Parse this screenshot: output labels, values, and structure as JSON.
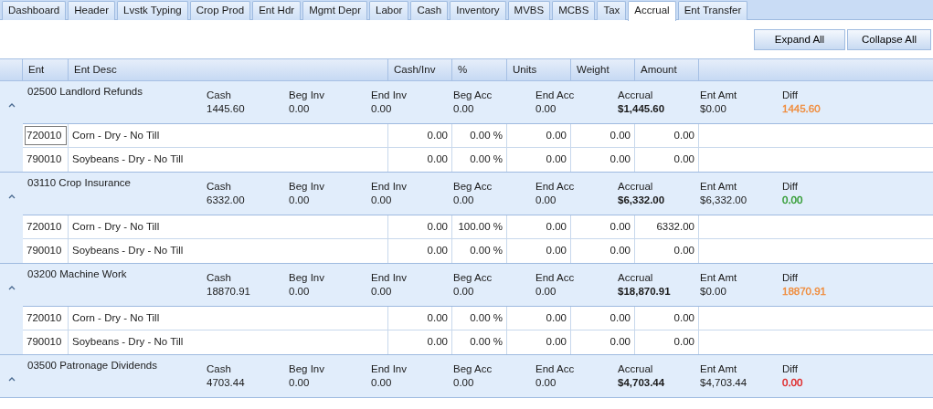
{
  "tabs": [
    {
      "label": "Dashboard",
      "selected": false
    },
    {
      "label": "Header",
      "selected": false
    },
    {
      "label": "Lvstk Typing",
      "selected": false
    },
    {
      "label": "Crop Prod",
      "selected": false
    },
    {
      "label": "Ent Hdr",
      "selected": false
    },
    {
      "label": "Mgmt Depr",
      "selected": false
    },
    {
      "label": "Labor",
      "selected": false
    },
    {
      "label": "Cash",
      "selected": false
    },
    {
      "label": "Inventory",
      "selected": false
    },
    {
      "label": "MVBS",
      "selected": false
    },
    {
      "label": "MCBS",
      "selected": false
    },
    {
      "label": "Tax",
      "selected": false
    },
    {
      "label": "Accrual",
      "selected": true
    },
    {
      "label": "Ent Transfer",
      "selected": false
    }
  ],
  "buttons": [
    "Expand All",
    "Collapse All"
  ],
  "columns": [
    "Ent",
    "Ent Desc",
    "Cash/Inv",
    "%",
    "Units",
    "Weight",
    "Amount"
  ],
  "groups": [
    {
      "title": "02500 Landlord Refunds",
      "expanded": true,
      "summary": [
        {
          "label": "Cash",
          "value": "1445.60"
        },
        {
          "label": "Beg Inv",
          "value": "0.00"
        },
        {
          "label": "End Inv",
          "value": "0.00"
        },
        {
          "label": "Beg Acc",
          "value": "0.00"
        },
        {
          "label": "End Acc",
          "value": "0.00"
        },
        {
          "label": "Accrual",
          "value": "$1,445.60",
          "bold": true
        },
        {
          "label": "Ent Amt",
          "value": "$0.00"
        },
        {
          "label": "Diff",
          "value": "1445.60",
          "color": "#f08c3c"
        }
      ],
      "rows": [
        {
          "ent": "720010",
          "desc": "Corn - Dry - No Till",
          "cash_inv": "0.00",
          "pct": "0.00 %",
          "units": "0.00",
          "weight": "0.00",
          "amount": "0.00",
          "focused": true
        },
        {
          "ent": "790010",
          "desc": "Soybeans - Dry - No Till",
          "cash_inv": "0.00",
          "pct": "0.00 %",
          "units": "0.00",
          "weight": "0.00",
          "amount": "0.00",
          "focused": false
        }
      ]
    },
    {
      "title": "03110 Crop Insurance",
      "expanded": true,
      "summary": [
        {
          "label": "Cash",
          "value": "6332.00"
        },
        {
          "label": "Beg Inv",
          "value": "0.00"
        },
        {
          "label": "End Inv",
          "value": "0.00"
        },
        {
          "label": "Beg Acc",
          "value": "0.00"
        },
        {
          "label": "End Acc",
          "value": "0.00"
        },
        {
          "label": "Accrual",
          "value": "$6,332.00",
          "bold": true
        },
        {
          "label": "Ent Amt",
          "value": "$6,332.00"
        },
        {
          "label": "Diff",
          "value": "0.00",
          "color": "#2e9a2e"
        }
      ],
      "rows": [
        {
          "ent": "720010",
          "desc": "Corn - Dry - No Till",
          "cash_inv": "0.00",
          "pct": "100.00 %",
          "units": "0.00",
          "weight": "0.00",
          "amount": "6332.00",
          "focused": false
        },
        {
          "ent": "790010",
          "desc": "Soybeans - Dry - No Till",
          "cash_inv": "0.00",
          "pct": "0.00 %",
          "units": "0.00",
          "weight": "0.00",
          "amount": "0.00",
          "focused": false
        }
      ]
    },
    {
      "title": "03200 Machine Work",
      "expanded": true,
      "summary": [
        {
          "label": "Cash",
          "value": "18870.91"
        },
        {
          "label": "Beg Inv",
          "value": "0.00"
        },
        {
          "label": "End Inv",
          "value": "0.00"
        },
        {
          "label": "Beg Acc",
          "value": "0.00"
        },
        {
          "label": "End Acc",
          "value": "0.00"
        },
        {
          "label": "Accrual",
          "value": "$18,870.91",
          "bold": true
        },
        {
          "label": "Ent Amt",
          "value": "$0.00"
        },
        {
          "label": "Diff",
          "value": "18870.91",
          "color": "#f08c3c"
        }
      ],
      "rows": [
        {
          "ent": "720010",
          "desc": "Corn - Dry - No Till",
          "cash_inv": "0.00",
          "pct": "0.00 %",
          "units": "0.00",
          "weight": "0.00",
          "amount": "0.00",
          "focused": false
        },
        {
          "ent": "790010",
          "desc": "Soybeans - Dry - No Till",
          "cash_inv": "0.00",
          "pct": "0.00 %",
          "units": "0.00",
          "weight": "0.00",
          "amount": "0.00",
          "focused": false
        }
      ]
    },
    {
      "title": "03500 Patronage Dividends",
      "expanded": true,
      "summary": [
        {
          "label": "Cash",
          "value": "4703.44"
        },
        {
          "label": "Beg Inv",
          "value": "0.00"
        },
        {
          "label": "End Inv",
          "value": "0.00"
        },
        {
          "label": "Beg Acc",
          "value": "0.00"
        },
        {
          "label": "End Acc",
          "value": "0.00"
        },
        {
          "label": "Accrual",
          "value": "$4,703.44",
          "bold": true
        },
        {
          "label": "Ent Amt",
          "value": "$4,703.44"
        },
        {
          "label": "Diff",
          "value": "0.00",
          "color": "#e02424"
        }
      ]
    }
  ]
}
